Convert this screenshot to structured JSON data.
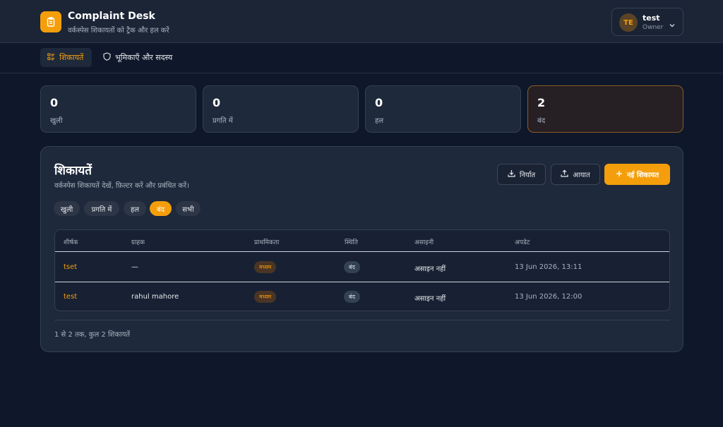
{
  "app": {
    "title": "Complaint Desk",
    "subtitle": "वर्कस्पेस शिकायतों को ट्रैक और हल करें"
  },
  "user": {
    "initials": "TE",
    "name": "test",
    "role": "Owner"
  },
  "nav": {
    "tabs": [
      {
        "label": "शिकायतें",
        "active": true
      },
      {
        "label": "भूमिकाएँ और सदस्य",
        "active": false
      }
    ]
  },
  "stats": [
    {
      "value": "0",
      "label": "खुली"
    },
    {
      "value": "0",
      "label": "प्रगति में"
    },
    {
      "value": "0",
      "label": "हल"
    },
    {
      "value": "2",
      "label": "बंद"
    }
  ],
  "panel": {
    "title": "शिकायतें",
    "subtitle": "वर्कस्पेस शिकायतें देखें, फ़िल्टर करें और प्रबंधित करें।",
    "buttons": {
      "export": "निर्यात",
      "import": "आयात",
      "new": "नई शिकायत"
    },
    "filters": [
      "खुली",
      "प्रगति में",
      "हल",
      "बंद",
      "सभी"
    ],
    "active_filter": "बंद"
  },
  "table": {
    "columns": [
      "शीर्षक",
      "ग्राहक",
      "प्राथमिकता",
      "स्थिति",
      "असाइनी",
      "अपडेट"
    ],
    "rows": [
      {
        "title": "tset",
        "customer": "—",
        "priority": "मध्यम",
        "status": "बंद",
        "assignee": "असाइन नहीं",
        "updated": "13 Jun 2026, 13:11"
      },
      {
        "title": "test",
        "customer": "rahul mahore",
        "priority": "मध्यम",
        "status": "बंद",
        "assignee": "असाइन नहीं",
        "updated": "13 Jun 2026, 12:00"
      }
    ]
  },
  "footer": {
    "summary": "1 से 2 तक, कुल 2 शिकायतें"
  },
  "colors": {
    "accent": "#f59e0b",
    "background": "#0f172a",
    "card": "#1e293b"
  },
  "icons": [
    "clipboard-icon",
    "chevron-down-icon",
    "list-icon",
    "shield-icon",
    "download-icon",
    "upload-icon",
    "plus-icon"
  ]
}
